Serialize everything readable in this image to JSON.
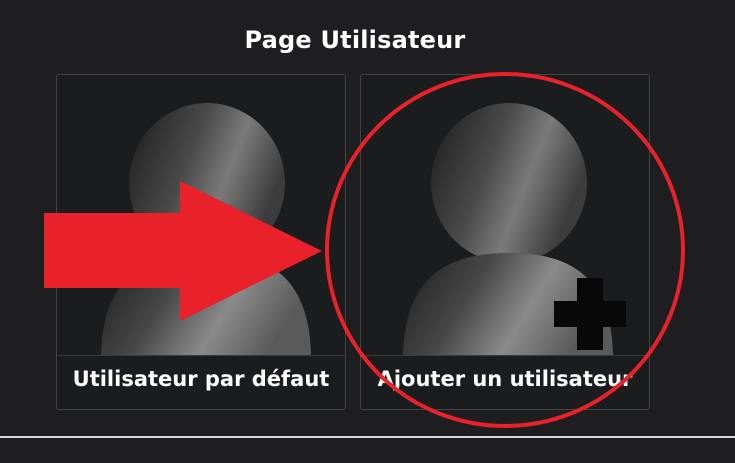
{
  "page": {
    "title": "Page Utilisateur"
  },
  "cards": [
    {
      "label": "Utilisateur par défaut",
      "icon": "user-avatar-icon"
    },
    {
      "label": "Ajouter un utilisateur",
      "icon": "add-user-avatar-icon"
    }
  ],
  "colors": {
    "background": "#1e1e20",
    "annotation": "#e8212b",
    "text": "#ffffff"
  }
}
